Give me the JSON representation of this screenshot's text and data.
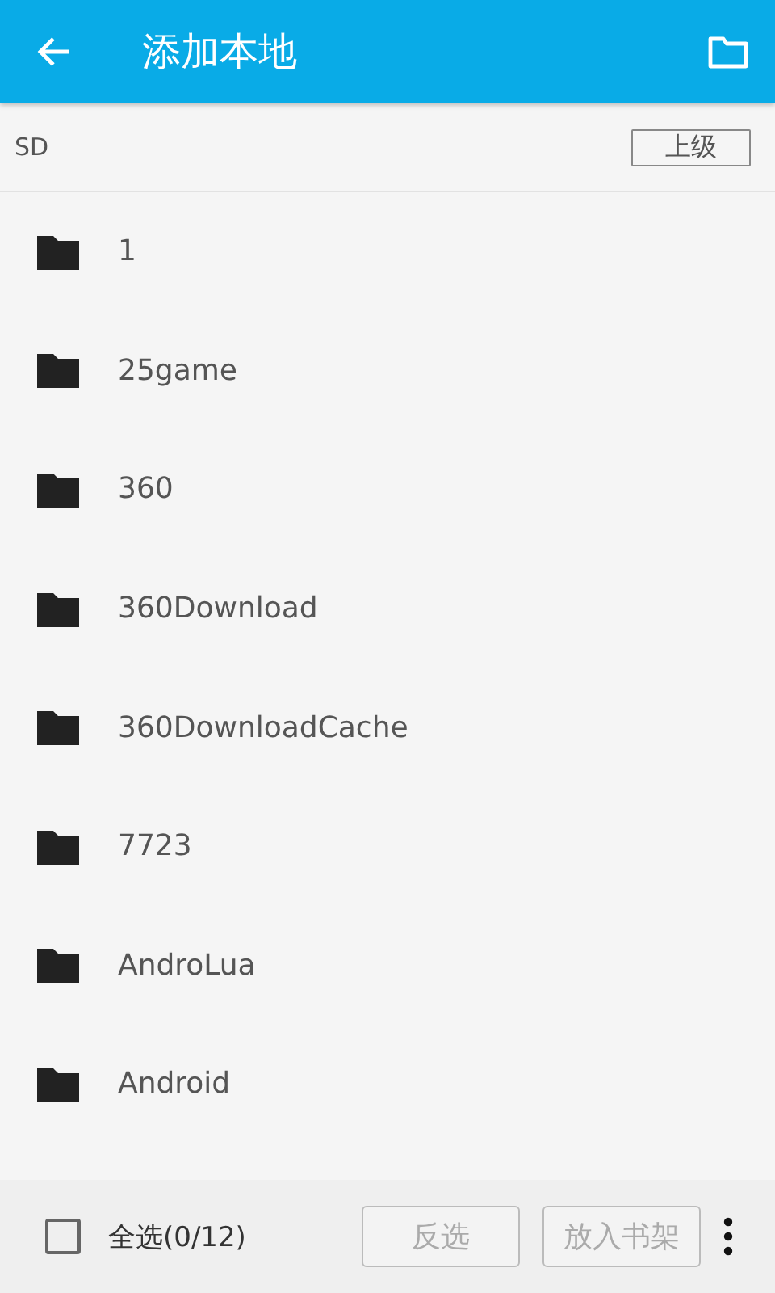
{
  "app_bar": {
    "title": "添加本地"
  },
  "path_bar": {
    "path": "SD",
    "up_button": "上级"
  },
  "folders": [
    {
      "name": "1"
    },
    {
      "name": "25game"
    },
    {
      "name": "360"
    },
    {
      "name": "360Download"
    },
    {
      "name": "360DownloadCache"
    },
    {
      "name": "7723"
    },
    {
      "name": "AndroLua"
    },
    {
      "name": "Android"
    }
  ],
  "bottom_bar": {
    "select_all": {
      "label": "全选(0/12)",
      "checked": false
    },
    "buttons": [
      {
        "label": "反选",
        "disabled": true
      },
      {
        "label": "放入书架",
        "disabled": true
      }
    ]
  }
}
